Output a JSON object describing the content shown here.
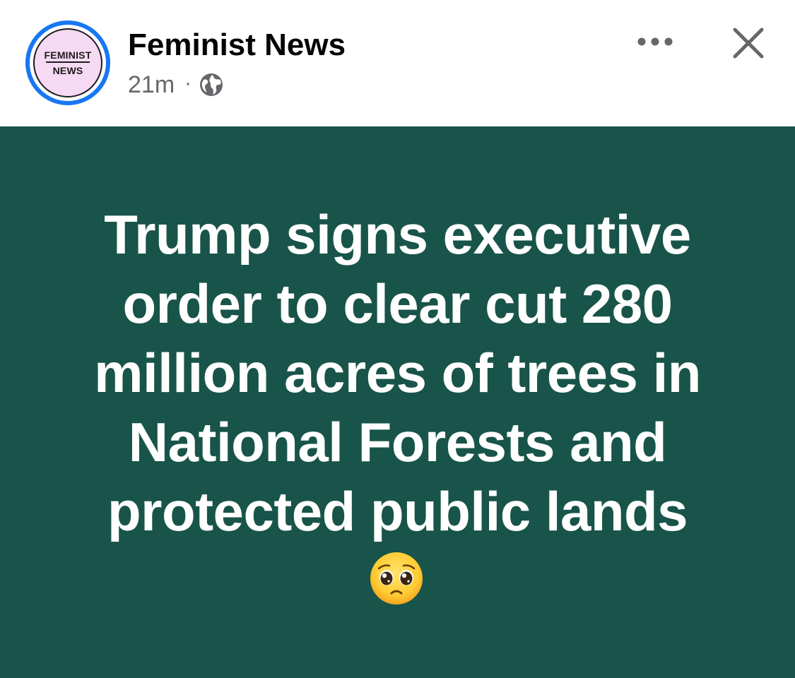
{
  "header": {
    "avatar": {
      "logo_line1": "FEMINIST",
      "logo_line2": "NEWS",
      "ring_color": "#1877f2",
      "fill_color": "#f6d9f3"
    },
    "page_name": "Feminist News",
    "timestamp": "21m",
    "separator": "·",
    "audience_icon": "globe-icon",
    "more_icon": "more-horizontal-icon",
    "close_icon": "close-icon"
  },
  "post": {
    "background_color": "#185449",
    "text": "Trump signs executive order to clear cut 280 million acres of trees in National Forests and protected public lands",
    "emoji": "pleading-face-emoji"
  }
}
